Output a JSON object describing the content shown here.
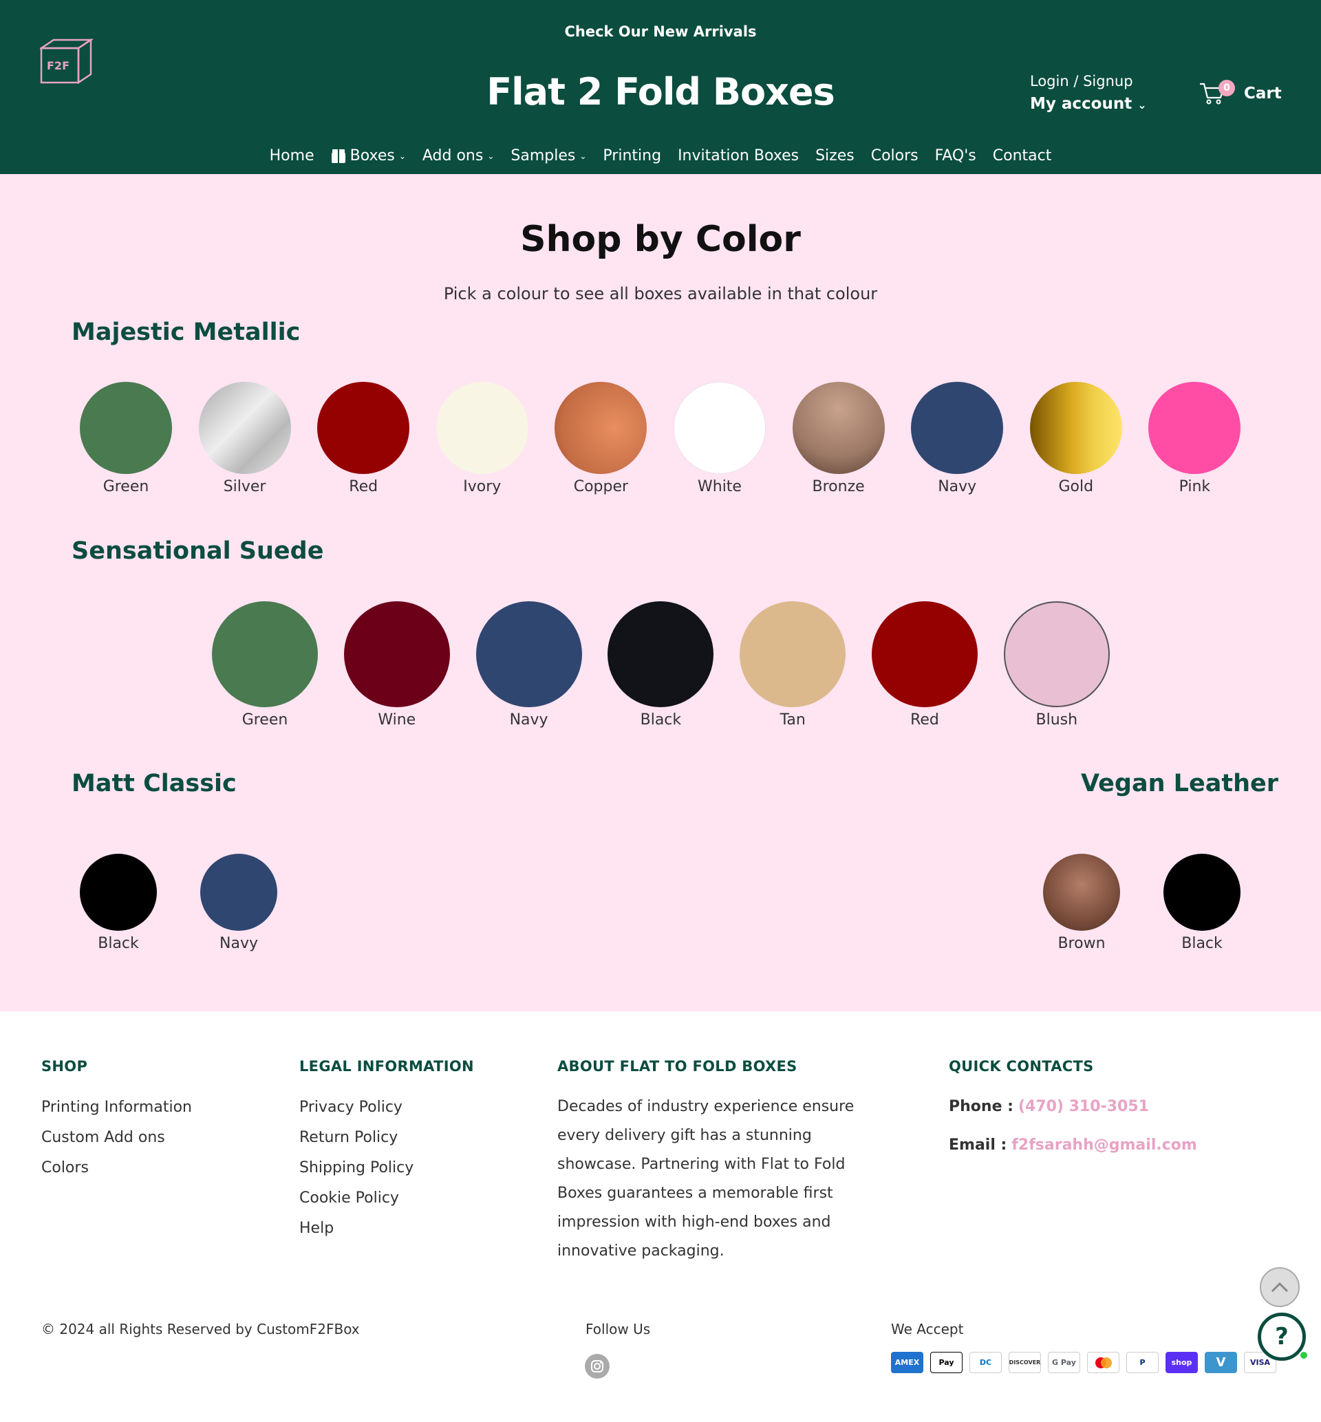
{
  "header": {
    "announcement": "Check Our New Arrivals",
    "logo_text": "F2F",
    "site_title": "Flat 2 Fold Boxes",
    "login": "Login / Signup",
    "my_account": "My account",
    "cart_count": "0",
    "cart_label": "Cart"
  },
  "nav": {
    "home": "Home",
    "boxes": "Boxes",
    "addons": "Add ons",
    "samples": "Samples",
    "printing": "Printing",
    "invitation": "Invitation Boxes",
    "sizes": "Sizes",
    "colors": "Colors",
    "faqs": "FAQ's",
    "contact": "Contact"
  },
  "main": {
    "title": "Shop by Color",
    "subtitle": "Pick a colour to see all boxes available in that colour",
    "sections": {
      "metallic": {
        "title": "Majestic Metallic",
        "swatches": [
          {
            "name": "Green",
            "color": "#4a7a50"
          },
          {
            "name": "Silver",
            "color": "#c8c8c8"
          },
          {
            "name": "Red",
            "color": "#950000"
          },
          {
            "name": "Ivory",
            "color": "#f8f5e4"
          },
          {
            "name": "Copper",
            "color": "#d9805a"
          },
          {
            "name": "White",
            "color": "#ffffff"
          },
          {
            "name": "Bronze",
            "color": "#a88470"
          },
          {
            "name": "Navy",
            "color": "#2f4670"
          },
          {
            "name": "Gold",
            "color": "#d4a820"
          },
          {
            "name": "Pink",
            "color": "#ff4da6"
          }
        ]
      },
      "suede": {
        "title": "Sensational Suede",
        "swatches": [
          {
            "name": "Green",
            "color": "#4a7a50"
          },
          {
            "name": "Wine",
            "color": "#6b0018"
          },
          {
            "name": "Navy",
            "color": "#2f4670"
          },
          {
            "name": "Black",
            "color": "#111318"
          },
          {
            "name": "Tan",
            "color": "#dbb98c"
          },
          {
            "name": "Red",
            "color": "#950000"
          },
          {
            "name": "Blush",
            "color": "#e8bfd3"
          }
        ]
      },
      "matt": {
        "title": "Matt Classic",
        "swatches": [
          {
            "name": "Black",
            "color": "#000000"
          },
          {
            "name": "Navy",
            "color": "#2f4670"
          }
        ]
      },
      "vegan": {
        "title": "Vegan Leather",
        "swatches": [
          {
            "name": "Brown",
            "color": "#8a5a48"
          },
          {
            "name": "Black",
            "color": "#000000"
          }
        ]
      }
    }
  },
  "footer": {
    "shop": {
      "heading": "SHOP",
      "links": [
        "Printing Information",
        "Custom Add ons",
        "Colors"
      ]
    },
    "legal": {
      "heading": "LEGAL INFORMATION",
      "links": [
        "Privacy Policy",
        "Return Policy",
        "Shipping Policy",
        "Cookie Policy",
        "Help"
      ]
    },
    "about": {
      "heading": "ABOUT FLAT TO FOLD BOXES",
      "text": "Decades of industry experience ensure every delivery gift has a stunning showcase. Partnering with Flat to Fold Boxes guarantees a memorable first impression with high-end boxes and innovative packaging."
    },
    "contacts": {
      "heading": "QUICK CONTACTS",
      "phone_label": "Phone :",
      "phone": "(470) 310-3051",
      "email_label": "Email :",
      "email": "f2fsarahh@gmail.com"
    },
    "copyright": "© 2024 all Rights Reserved by CustomF2FBox",
    "follow": "Follow Us",
    "accept": "We Accept",
    "payments": [
      "AMEX",
      "Pay",
      "DC",
      "DISCOVER",
      "G Pay",
      "MC",
      "P",
      "shop",
      "V",
      "VISA"
    ]
  },
  "colors": {
    "brand_green": "#0b4d3f",
    "page_pink": "#ffe4f2",
    "accent_pink": "#e8a3c4"
  }
}
